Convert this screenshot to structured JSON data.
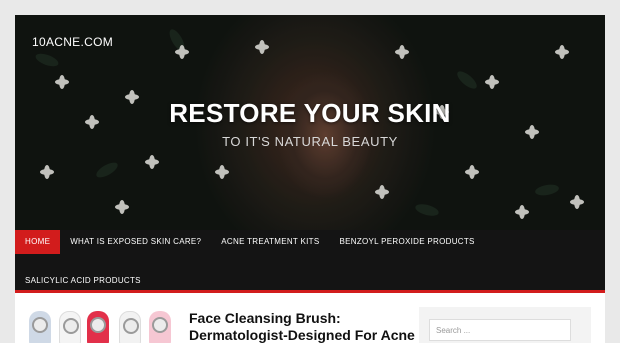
{
  "site": {
    "title": "10ACNE.COM"
  },
  "hero": {
    "title": "RESTORE YOUR SKIN",
    "subtitle": "TO IT'S NATURAL BEAUTY"
  },
  "nav": {
    "items": [
      {
        "label": "HOME",
        "active": true
      },
      {
        "label": "WHAT IS EXPOSED SKIN CARE?"
      },
      {
        "label": "ACNE TREATMENT KITS"
      },
      {
        "label": "BENZOYL PEROXIDE PRODUCTS"
      },
      {
        "label": "SALICYLIC ACID PRODUCTS"
      }
    ],
    "accent_color": "#d21c1c"
  },
  "post": {
    "title": "Face Cleansing Brush: Dermatologist-Designed For Acne"
  },
  "sidebar": {
    "search_placeholder": "Search ..."
  }
}
